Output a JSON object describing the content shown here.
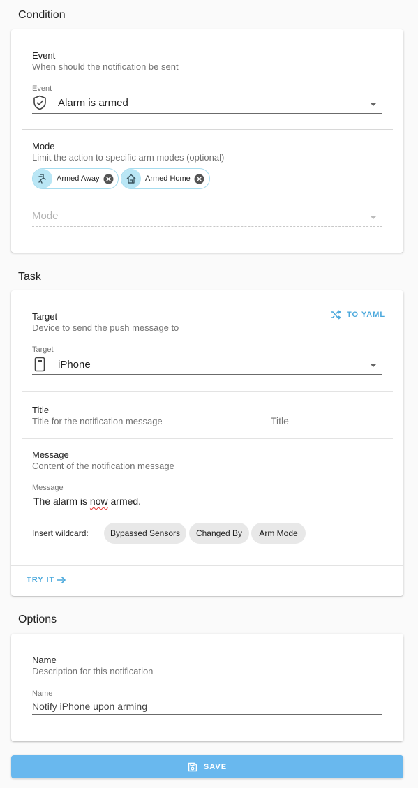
{
  "condition": {
    "title": "Condition",
    "event": {
      "header": "Event",
      "description": "When should the notification be sent",
      "field_label": "Event",
      "value": "Alarm is armed",
      "icon": "shield-check-icon"
    },
    "mode": {
      "header": "Mode",
      "description": "Limit the action to specific arm modes (optional)",
      "chips": [
        {
          "label": "Armed Away",
          "icon": "walk-icon"
        },
        {
          "label": "Armed Home",
          "icon": "home-icon"
        }
      ],
      "placeholder": "Mode"
    }
  },
  "task": {
    "title": "Task",
    "to_yaml_label": "TO YAML",
    "target": {
      "header": "Target",
      "description": "Device to send the push message to",
      "field_label": "Target",
      "value": "iPhone",
      "icon": "cellphone-icon"
    },
    "title_field": {
      "header": "Title",
      "description": "Title for the notification message",
      "placeholder": "Title"
    },
    "message": {
      "header": "Message",
      "description": "Content of the notification message",
      "field_label": "Message",
      "value_prefix": "The alarm is ",
      "value_misspelled": "now",
      "value_suffix": " armed."
    },
    "wildcard": {
      "label": "Insert wildcard:",
      "chips": [
        "Bypassed Sensors",
        "Changed By",
        "Arm Mode"
      ]
    },
    "try_it_label": "TRY IT"
  },
  "options": {
    "title": "Options",
    "name": {
      "header": "Name",
      "description": "Description for this notification",
      "field_label": "Name",
      "value": "Notify iPhone upon arming"
    }
  },
  "save_label": "SAVE",
  "colors": {
    "accent": "#4aa8dc",
    "save_button": "#69b8ee",
    "chip_avatar": "#b9e6f5"
  }
}
